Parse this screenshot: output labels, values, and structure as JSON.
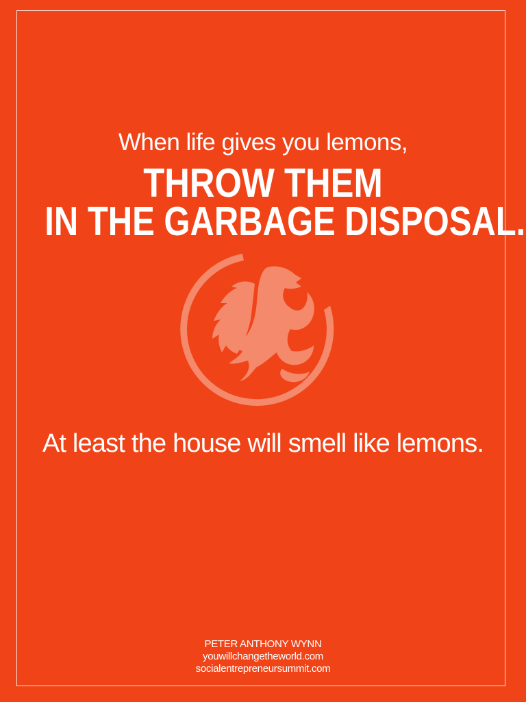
{
  "poster": {
    "background_color": "#f04418",
    "text_color": "#ffffff",
    "emblem_color": "#f4896b",
    "intro_line": "When life gives you lemons,",
    "headline_line_1": "THROW THEM",
    "headline_line_2": "IN THE GARBAGE DISPOSAL.",
    "emblem_icon": "griffin-emblem-icon",
    "punchline": "At least the house will smell like lemons.",
    "credits": {
      "author": "PETER ANTHONY WYNN",
      "website_1": "youwillchangetheworld.com",
      "website_2": "socialentrepreneursummit.com"
    }
  }
}
